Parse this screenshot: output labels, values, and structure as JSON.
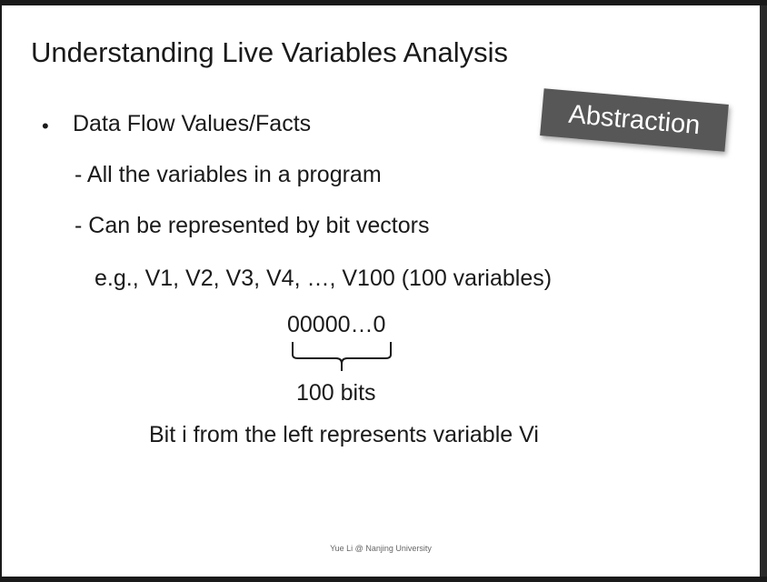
{
  "slide": {
    "title": "Understanding Live Variables Analysis",
    "badge": "Abstraction",
    "bullet_symbol": "•",
    "bullet": "Data Flow Values/Facts",
    "sub_items": [
      "-  All the variables in a program",
      "- Can be represented by bit vectors"
    ],
    "example": "e.g., V1, V2, V3, V4, …, V100 (100 variables)",
    "bit_vector": "00000…0",
    "bits_label": "100 bits",
    "statement": "Bit i from the left represents variable Vi",
    "footer": "Yue Li @ Nanjing University"
  },
  "colors": {
    "badge_bg": "#575757",
    "text": "#1a1a1a",
    "background": "#ffffff"
  }
}
